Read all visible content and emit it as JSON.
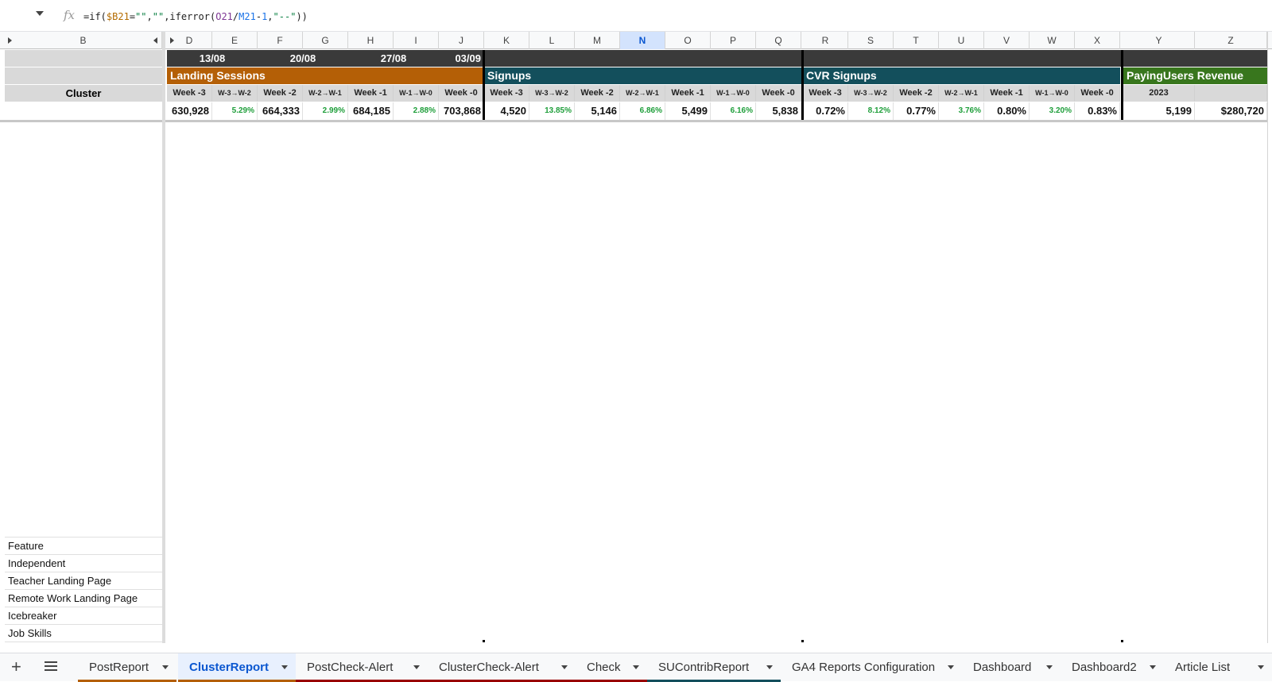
{
  "formula_bar": {
    "fx_label": "fx"
  },
  "columns": [
    "B",
    "D",
    "E",
    "F",
    "G",
    "H",
    "I",
    "J",
    "K",
    "L",
    "M",
    "N",
    "O",
    "P",
    "Q",
    "R",
    "S",
    "T",
    "U",
    "V",
    "W",
    "X",
    "Y",
    "Z"
  ],
  "selected_column": "N",
  "dates": [
    "13/08",
    "20/08",
    "27/08",
    "03/09"
  ],
  "sections": {
    "landing": "Landing Sessions",
    "signups": "Signups",
    "cvr": "CVR Signups",
    "paying": "PayingUsers Revenue"
  },
  "cluster_label": "Cluster",
  "week_headers": [
    "Week -3",
    "W-3→W-2",
    "Week -2",
    "W-2→W-1",
    "Week -1",
    "W-1→W-0",
    "Week -0"
  ],
  "year_label": "2023",
  "landing_values": [
    "630,928",
    "5.29%",
    "664,333",
    "2.99%",
    "684,185",
    "2.88%",
    "703,868"
  ],
  "signups_values": [
    "4,520",
    "13.85%",
    "5,146",
    "6.86%",
    "5,499",
    "6.16%",
    "5,838"
  ],
  "cvr_values": [
    "0.72%",
    "8.12%",
    "0.77%",
    "3.76%",
    "0.80%",
    "3.20%",
    "0.83%"
  ],
  "paying_values": [
    "5,199",
    "$280,720"
  ],
  "clusters": [
    "Feature",
    "Independent",
    "Teacher Landing Page",
    "Remote Work Landing Page",
    "Icebreaker",
    "Job Skills"
  ],
  "tabs": [
    {
      "label": "PostReport",
      "color": "#b45f06"
    },
    {
      "label": "ClusterReport",
      "color": "#b45f06",
      "active": true
    },
    {
      "label": "PostCheck-Alert",
      "color": "#990000"
    },
    {
      "label": "ClusterCheck-Alert",
      "color": "#990000"
    },
    {
      "label": "Check",
      "color": "#990000"
    },
    {
      "label": "SUContribReport",
      "color": "#134f5c"
    },
    {
      "label": "GA4 Reports Configuration",
      "color": ""
    },
    {
      "label": "Dashboard",
      "color": ""
    },
    {
      "label": "Dashboard2",
      "color": ""
    },
    {
      "label": "Article List",
      "color": ""
    }
  ],
  "colors": {
    "dark_header": "#3a3a3a",
    "landing": "#b45f06",
    "signups": "#134f5c",
    "paying": "#38761d",
    "positive": "#1e9e3a"
  }
}
